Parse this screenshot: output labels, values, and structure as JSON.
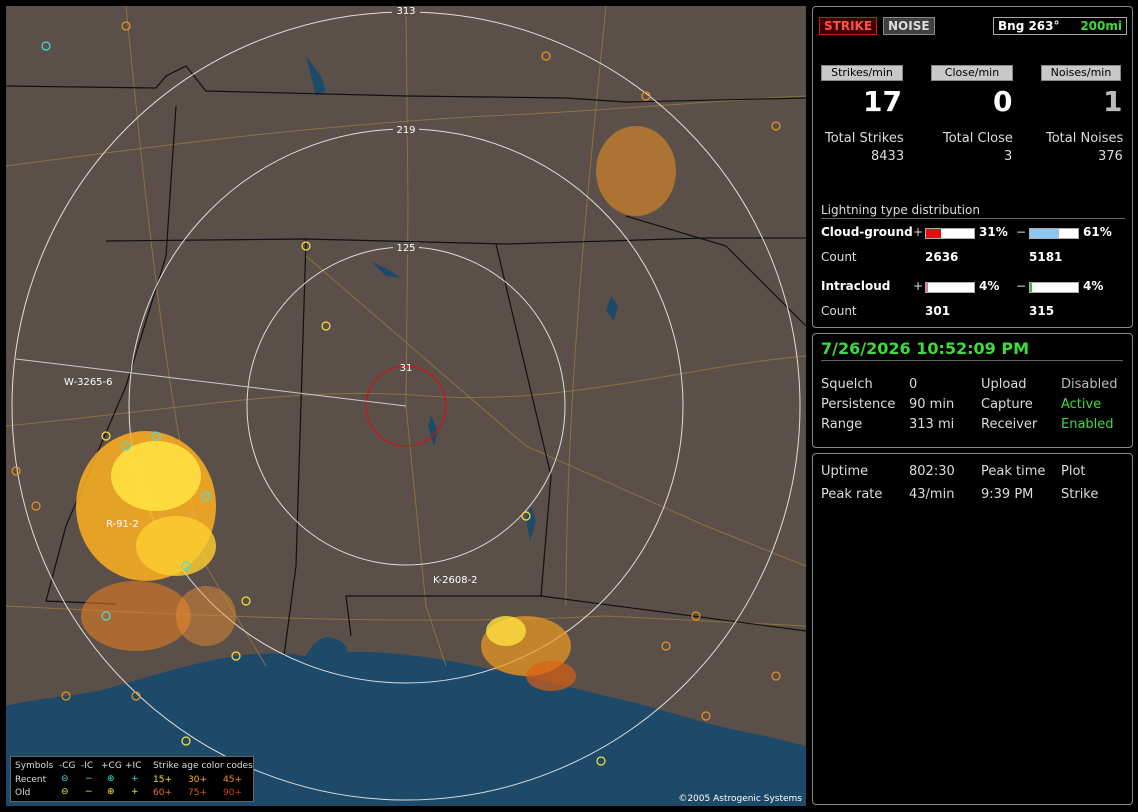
{
  "map": {
    "range_labels": [
      "313",
      "219",
      "125",
      "31"
    ],
    "station_labels": [
      "W-3265-6",
      "R-91-2",
      "K-2608-2"
    ],
    "copyright": "©2005 Astrogenic Systems",
    "colors": {
      "ground": "#5a5049",
      "water": "#1e4a6a",
      "ring": "#dddddd",
      "close_ring": "#d01010",
      "state_line": "#111111",
      "road": "#9a7a40"
    }
  },
  "legend": {
    "symbols_label": "Symbols",
    "cols": [
      "-CG",
      "-IC",
      "+CG",
      "+IC"
    ],
    "recent_label": "Recent",
    "old_label": "Old",
    "age_title": "Strike age color codes",
    "recent_ages": [
      "15+",
      "30+",
      "45+"
    ],
    "old_ages": [
      "60+",
      "75+",
      "90+"
    ]
  },
  "header": {
    "strike": "STRIKE",
    "noise": "NOISE",
    "bearing": "Bng 263°",
    "range": "200mi"
  },
  "rates": {
    "strikes_btn": "Strikes/min",
    "close_btn": "Close/min",
    "noises_btn": "Noises/min",
    "strikes": "17",
    "close": "0",
    "noises": "1",
    "total_strikes_label": "Total Strikes",
    "total_close_label": "Total Close",
    "total_noises_label": "Total Noises",
    "total_strikes": "8433",
    "total_close": "3",
    "total_noises": "376"
  },
  "distribution": {
    "title": "Lightning type distribution",
    "cg_label": "Cloud-ground",
    "ic_label": "Intracloud",
    "count_label": "Count",
    "plus": "+",
    "minus": "−",
    "cg_pos_pct": "31%",
    "cg_neg_pct": "61%",
    "ic_pos_pct": "4%",
    "ic_neg_pct": "4%",
    "cg_pos_count": "2636",
    "cg_neg_count": "5181",
    "ic_pos_count": "301",
    "ic_neg_count": "315",
    "fill": {
      "cg_pos": 0.31,
      "cg_neg": 0.61,
      "ic_pos": 0.04,
      "ic_neg": 0.04
    },
    "bar_colors": {
      "cg_pos": "#e01010",
      "cg_neg": "#8ec8f0",
      "ic_pos": "#e070a0",
      "ic_neg": "#30c030"
    }
  },
  "status": {
    "datetime": "7/26/2026 10:52:09 PM",
    "squelch_label": "Squelch",
    "squelch": "0",
    "persistence_label": "Persistence",
    "persistence": "90 min",
    "range_label": "Range",
    "range": "313 mi",
    "upload_label": "Upload",
    "upload": "Disabled",
    "capture_label": "Capture",
    "capture": "Active",
    "receiver_label": "Receiver",
    "receiver": "Enabled"
  },
  "stats": {
    "uptime_label": "Uptime",
    "uptime": "802:30",
    "peak_time_label": "Peak time",
    "peak_time": "9:39 PM",
    "plot_label": "Plot",
    "plot": "Strike",
    "peak_rate_label": "Peak rate",
    "peak_rate": "43/min"
  }
}
